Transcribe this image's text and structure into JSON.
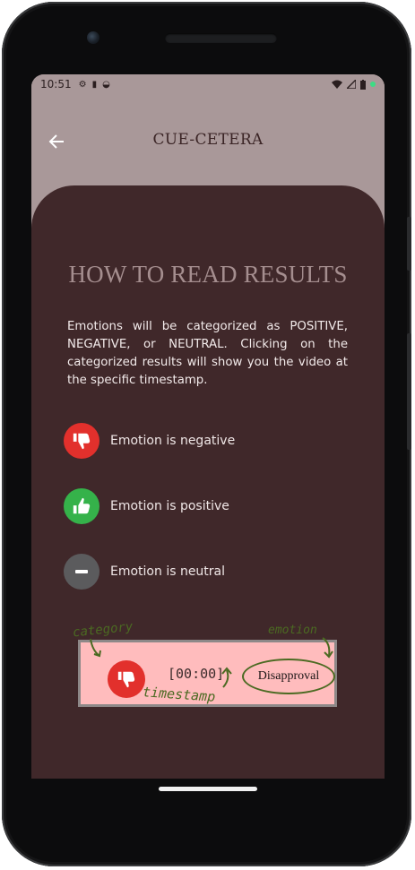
{
  "status_bar": {
    "time": "10:51"
  },
  "app_bar": {
    "title": "CUE-CETERA",
    "back_icon": "arrow-left-icon"
  },
  "content": {
    "title": "HOW TO READ RESULTS",
    "description": "Emotions will be categorized as POSITIVE, NEGATIVE, or NEUTRAL. Clicking on the categorized results will show you the video at the specific timestamp.",
    "legend": [
      {
        "icon": "thumbs-down-icon",
        "label": "Emotion is negative",
        "color": "#e2302c"
      },
      {
        "icon": "thumbs-up-icon",
        "label": "Emotion is positive",
        "color": "#35b24a"
      },
      {
        "icon": "minus-icon",
        "label": "Emotion is neutral",
        "color": "#5b5b5d"
      }
    ],
    "sample": {
      "category_note": "category",
      "emotion_note": "emotion",
      "timestamp_note": "timestamp",
      "timestamp": "[00:00]",
      "emotion": "Disapproval"
    }
  },
  "colors": {
    "app_background": "#a99899",
    "card_background": "#40282a",
    "sample_background": "#ffbcbd",
    "annotation": "#4b6a22"
  }
}
